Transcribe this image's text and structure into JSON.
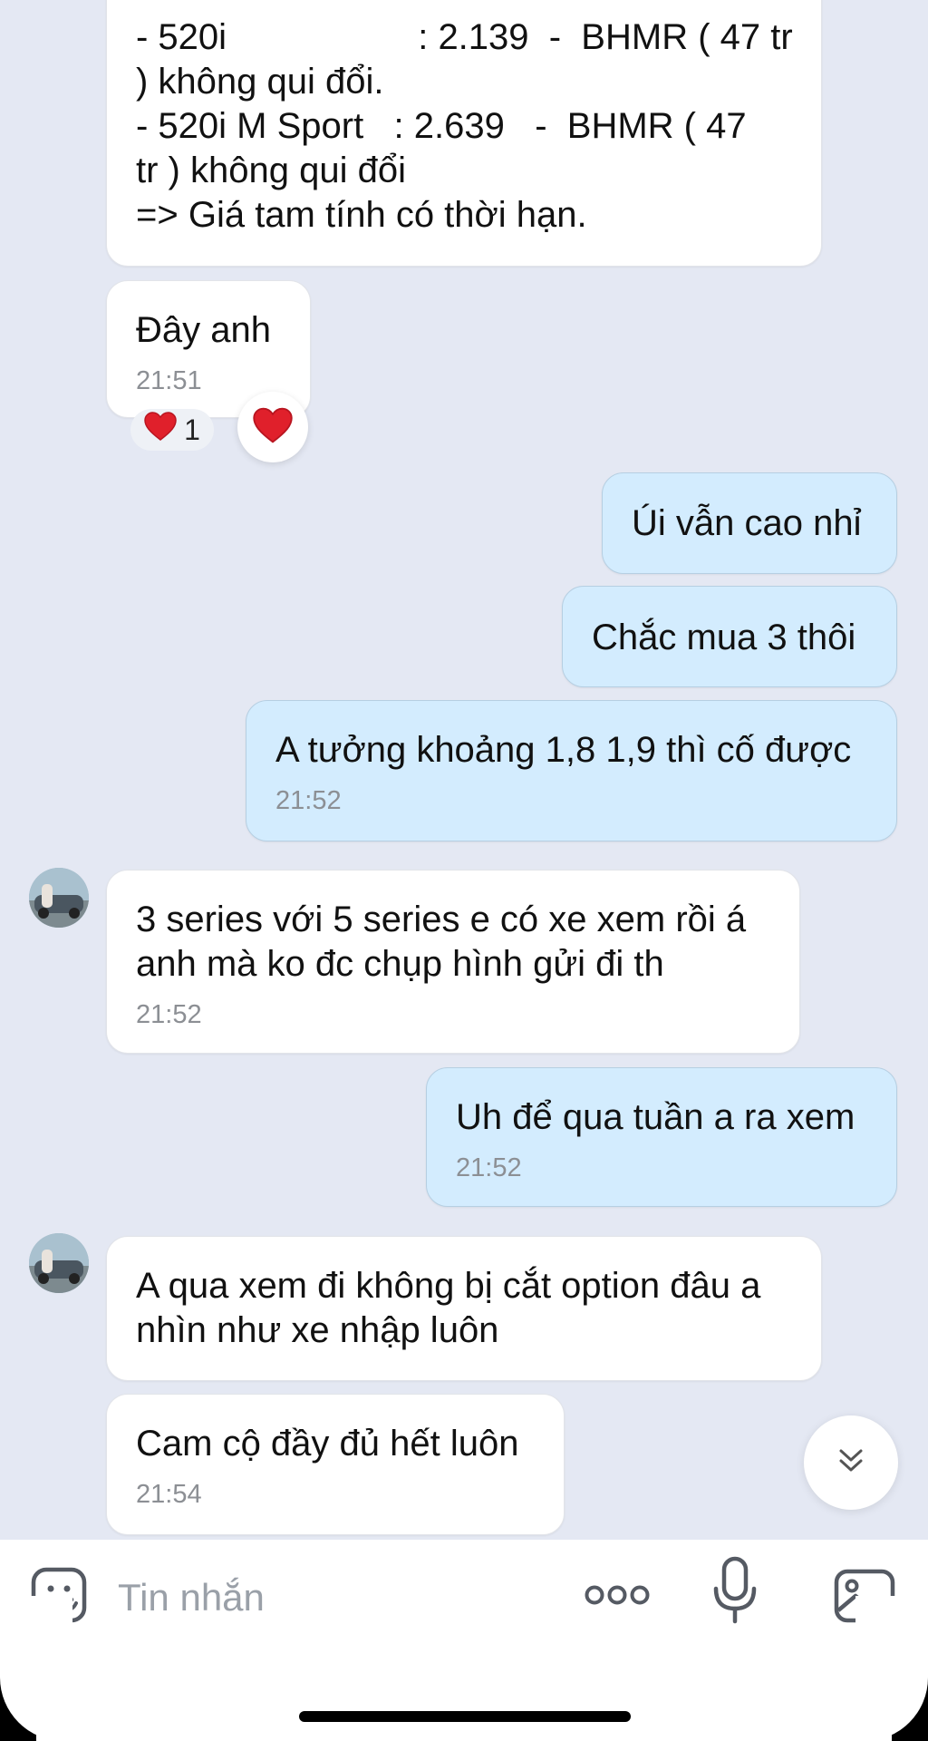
{
  "messages": [
    {
      "id": "m1",
      "side": "in",
      "lines": [
        "- 520i                   : 2.139  -  BHMR ( 47 tr",
        ") không qui đổi.",
        "- 520i M Sport   : 2.639   -  BHMR ( 47",
        "tr ) không qui đổi",
        "=> Giá tam tính có thời hạn."
      ],
      "time": ""
    },
    {
      "id": "m2",
      "side": "in",
      "lines": [
        "Đây anh"
      ],
      "time": "21:51"
    },
    {
      "id": "m3",
      "side": "out",
      "lines": [
        "Úi vẫn cao nhỉ"
      ],
      "time": ""
    },
    {
      "id": "m4",
      "side": "out",
      "lines": [
        "Chắc mua 3 thôi"
      ],
      "time": ""
    },
    {
      "id": "m5",
      "side": "out",
      "lines": [
        "A tưởng khoảng 1,8 1,9 thì cố được"
      ],
      "time": "21:52"
    },
    {
      "id": "m6",
      "side": "in",
      "lines": [
        "3 series với 5 series e có xe xem rồi á",
        "anh mà ko đc chụp hình gửi đi th"
      ],
      "time": "21:52"
    },
    {
      "id": "m7",
      "side": "out",
      "lines": [
        "Uh để qua tuần a ra xem"
      ],
      "time": "21:52"
    },
    {
      "id": "m8",
      "side": "in",
      "lines": [
        "A qua xem đi không bị cắt option đâu a",
        "nhìn như xe nhập luôn"
      ],
      "time": ""
    },
    {
      "id": "m9",
      "side": "in",
      "lines": [
        "Cam cộ đầy đủ hết luôn"
      ],
      "time": "21:54"
    }
  ],
  "reaction": {
    "icon": "heart-icon",
    "count": "1"
  },
  "composer": {
    "placeholder": "Tin nhắn"
  },
  "icons": {
    "sticker": "sticker-icon",
    "more": "more-dots-icon",
    "mic": "mic-icon",
    "image": "image-icon",
    "scroll": "chevron-double-down-icon"
  },
  "colors": {
    "incoming": "#ffffff",
    "outgoing": "#d3ecfe",
    "background": "#e4e8f3",
    "heart": "#e0202b"
  }
}
